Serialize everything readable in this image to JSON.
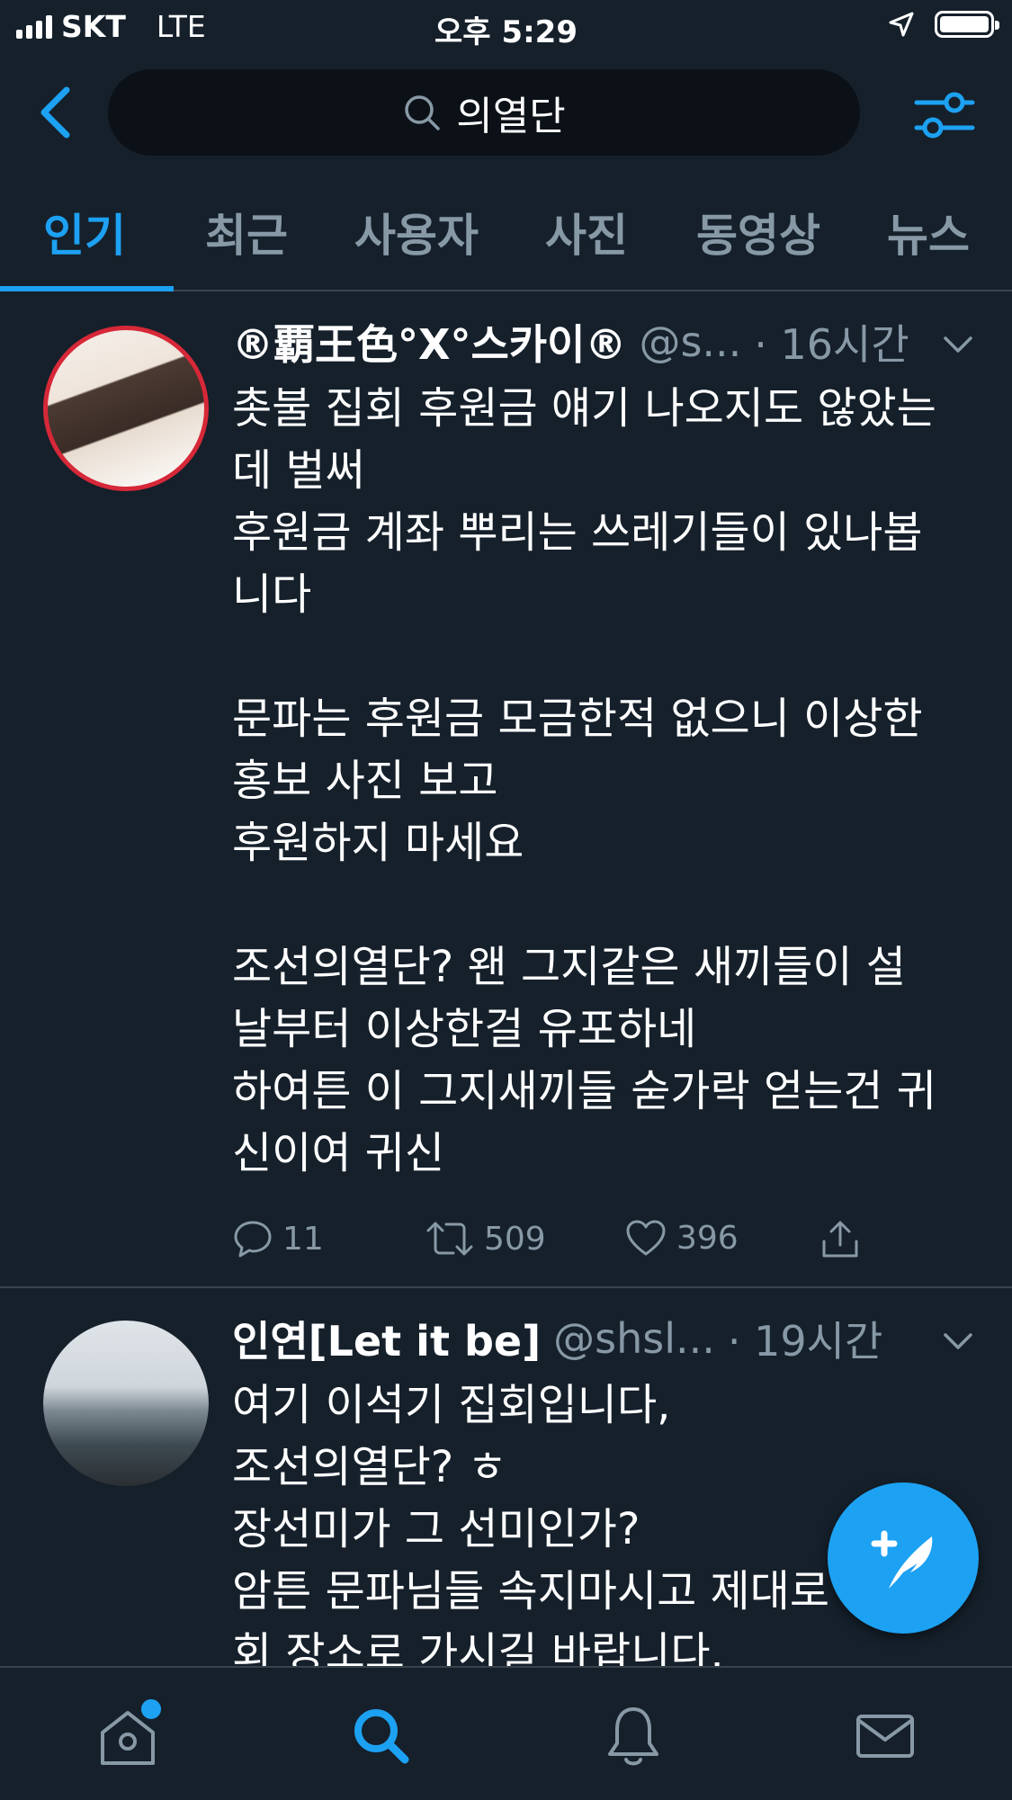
{
  "status_bar": {
    "carrier": "SKT",
    "network": "LTE",
    "time": "오후 5:29"
  },
  "search": {
    "query": "의열단"
  },
  "tabs": [
    {
      "label": "인기",
      "active": true
    },
    {
      "label": "최근",
      "active": false
    },
    {
      "label": "사용자",
      "active": false
    },
    {
      "label": "사진",
      "active": false
    },
    {
      "label": "동영상",
      "active": false
    },
    {
      "label": "뉴스",
      "active": false
    }
  ],
  "tweets": [
    {
      "name": "®覇王色°X°스카이®",
      "handle": "@s...",
      "time": "· 16시간",
      "lines": [
        "촛불 집회 후원금 얘기 나오지도 않았는",
        "데 벌써",
        "후원금 계좌 뿌리는 쓰레기들이 있나봅",
        "니다",
        "",
        "문파는 후원금 모금한적 없으니 이상한",
        "홍보 사진 보고",
        "후원하지 마세요",
        "",
        "조선의열단? 왠 그지같은 새끼들이 설",
        "날부터 이상한걸 유포하네",
        "하여튼 이 그지새끼들 숟가락 얻는건 귀",
        "신이여 귀신"
      ],
      "replies": "11",
      "retweets": "509",
      "likes": "396"
    },
    {
      "name": "인연[Let it be]",
      "handle": "@shsl...",
      "time": "· 19시간",
      "lines": [
        "여기 이석기 집회입니다,",
        "조선의열단? ㅎ",
        "장선미가 그 선미인가?",
        "암튼 문파님들 속지마시고 제대로",
        "회 장소로 가시길 바랍니다."
      ]
    }
  ],
  "colors": {
    "background": "#15202b",
    "accent": "#1da1f2",
    "secondary_text": "#8899a6",
    "divider": "#38444d"
  },
  "icons": {
    "back": "chevron-left-icon",
    "search": "search-icon",
    "filter": "sliders-icon",
    "reply": "comment-icon",
    "retweet": "retweet-icon",
    "like": "heart-icon",
    "share": "share-icon",
    "compose": "compose-feather-icon",
    "home": "home-icon",
    "explore": "search-icon",
    "notifications": "bell-icon",
    "messages": "mail-icon"
  }
}
